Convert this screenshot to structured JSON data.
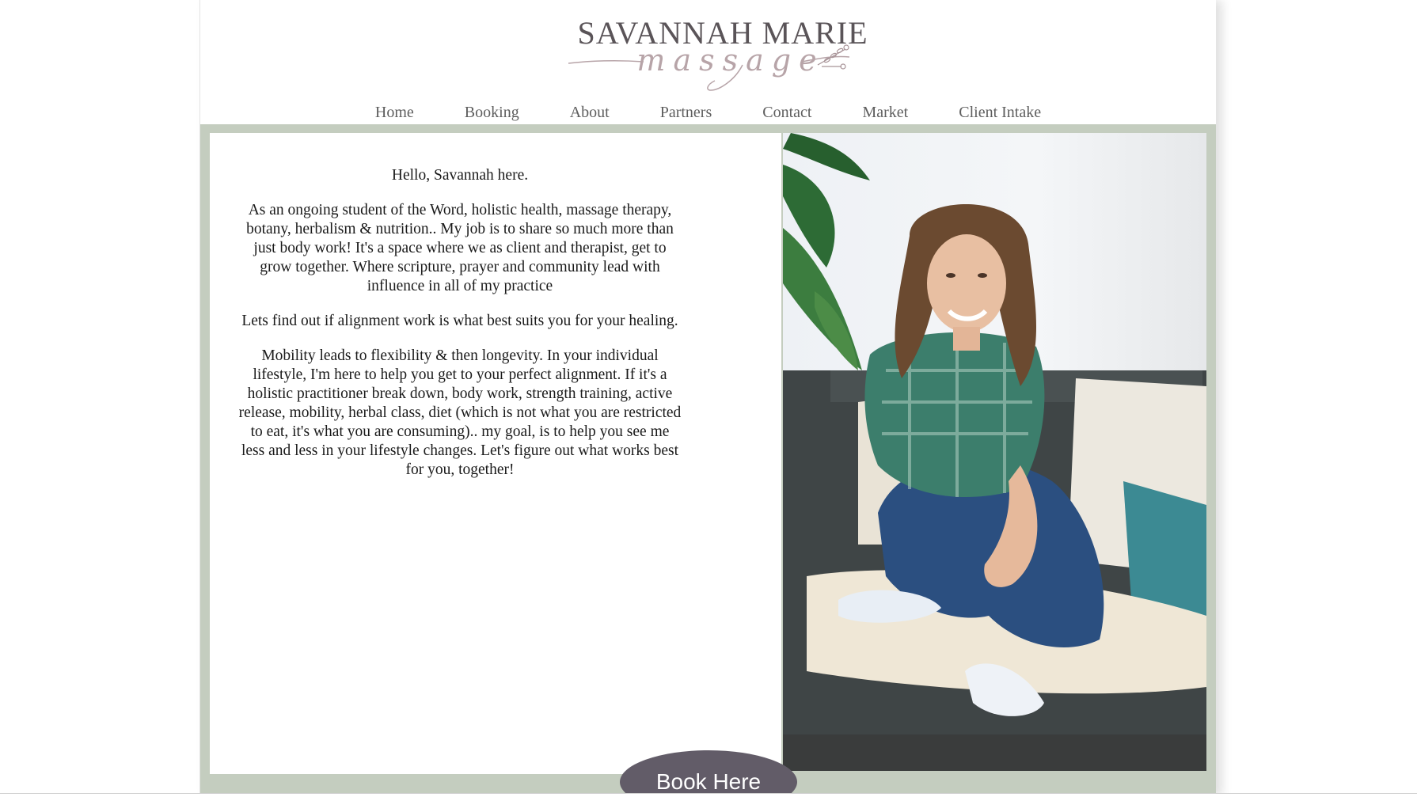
{
  "brand": {
    "name": "SAVANNAH MARIE",
    "tagline": "massage"
  },
  "nav": {
    "items": [
      {
        "label": "Home"
      },
      {
        "label": "Booking"
      },
      {
        "label": "About"
      },
      {
        "label": "Partners"
      },
      {
        "label": "Contact"
      },
      {
        "label": "Market"
      },
      {
        "label": "Client Intake"
      }
    ]
  },
  "content": {
    "greeting": "Hello, Savannah here.",
    "paragraph1": "As an ongoing student of the Word, holistic health, massage therapy, botany, herbalism & nutrition.. My job is to share so much more than just body work! It's a space where we as client and therapist, get to grow together. Where scripture, prayer and community lead with influence in all of my practice",
    "paragraph2": "Lets find out if alignment work is what best suits you for your healing.",
    "paragraph3": "Mobility leads to flexibility & then longevity. In your individual lifestyle, I'm here to help you get to your perfect alignment. If it's a holistic practitioner break down, body work, strength training, active release, mobility, herbal class, diet (which is not what you are restricted to eat, it's what you are consuming).. my goal, is to help you see me less and less in your lifestyle changes. Let's figure out what works best for you, together!"
  },
  "cta": {
    "book_label": "Book Here"
  },
  "colors": {
    "frame": "#c4cdbf",
    "button": "#625c68",
    "logo_text": "#5a5458",
    "logo_script": "#b7a4a8"
  }
}
